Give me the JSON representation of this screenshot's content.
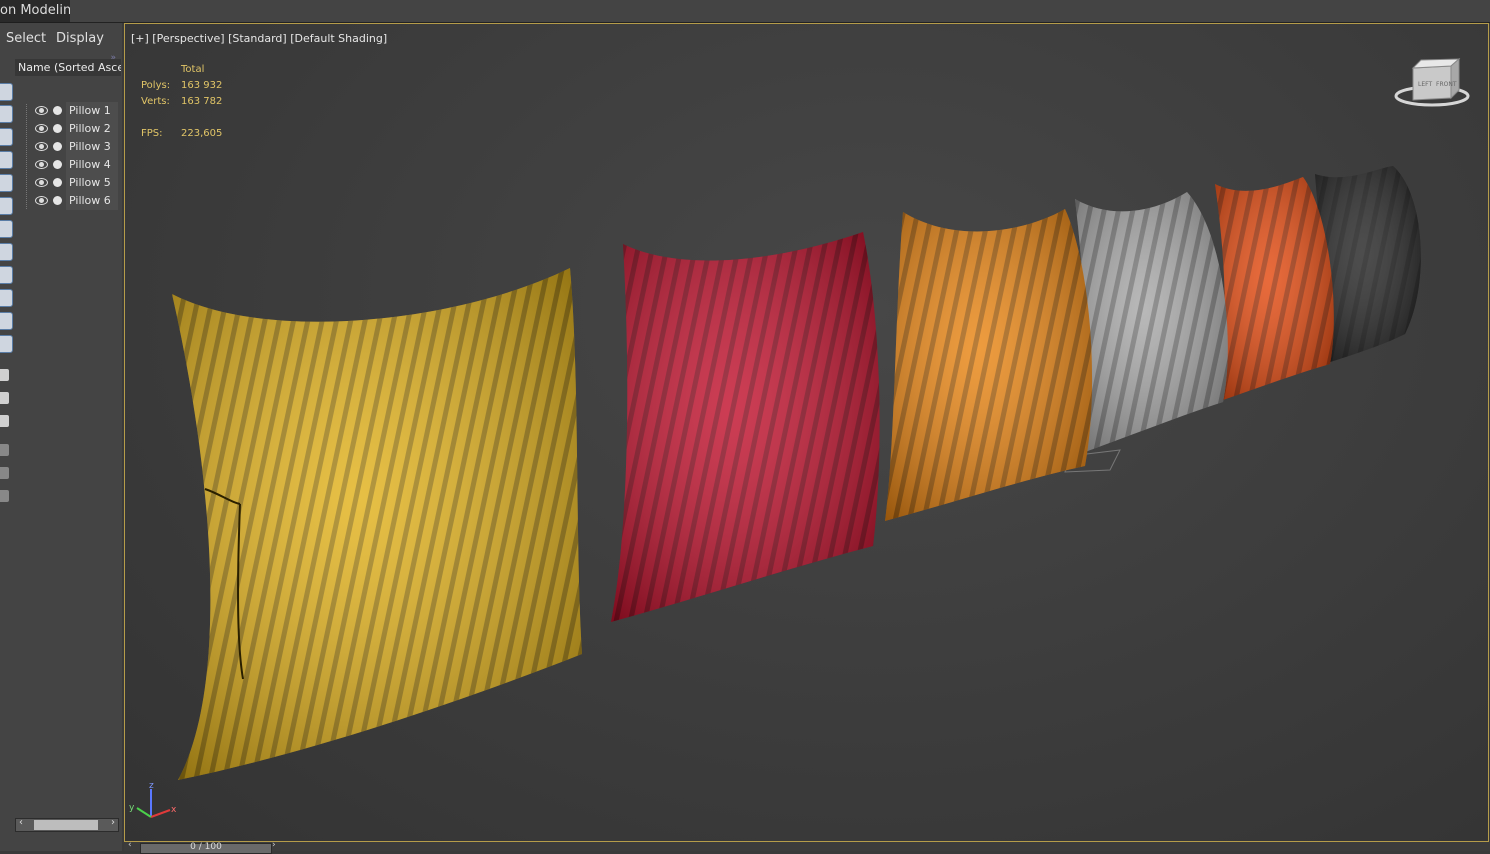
{
  "app": {
    "tab_title": "on Modeling"
  },
  "scene_explorer": {
    "menu": [
      "Select",
      "Display"
    ],
    "more_glyph": "»",
    "column_header": "Name (Sorted Ascending)",
    "items": [
      {
        "label": "Pillow 1"
      },
      {
        "label": "Pillow 2"
      },
      {
        "label": "Pillow 3"
      },
      {
        "label": "Pillow 4"
      },
      {
        "label": "Pillow 5"
      },
      {
        "label": "Pillow 6"
      }
    ]
  },
  "viewport": {
    "label": "[+] [Perspective] [Standard] [Default Shading]",
    "stats": {
      "total_label": "Total",
      "polys_label": "Polys:",
      "polys_value": "163 932",
      "verts_label": "Verts:",
      "verts_value": "163 782",
      "fps_label": "FPS:",
      "fps_value": "223,605"
    },
    "viewcube_faces": [
      "LEFT",
      "FRONT"
    ],
    "axis_labels": [
      "z",
      "y",
      "x"
    ],
    "pillow_colors": [
      "#e2b21c",
      "#c2122e",
      "#ea8614",
      "#a9a9a9",
      "#e44a10",
      "#262626"
    ]
  },
  "timeline": {
    "frame_label": "0 / 100"
  }
}
